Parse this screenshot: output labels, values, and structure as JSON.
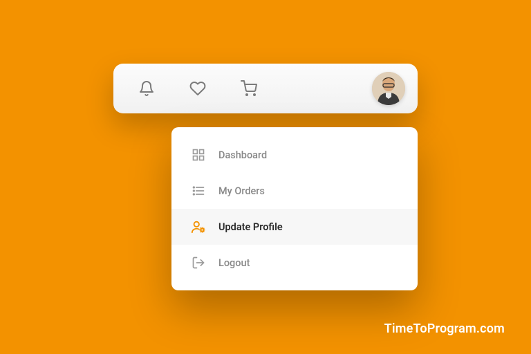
{
  "colors": {
    "background": "#f39200",
    "accent": "#f39200",
    "icon": "#7b7b7b",
    "text_muted": "#888888",
    "text_active": "#2b2b2b"
  },
  "toolbar": {
    "icons": [
      "bell",
      "heart",
      "cart"
    ]
  },
  "menu": {
    "items": [
      {
        "icon": "grid",
        "label": "Dashboard",
        "active": false
      },
      {
        "icon": "list",
        "label": "My Orders",
        "active": false
      },
      {
        "icon": "user-gear",
        "label": "Update Profile",
        "active": true
      },
      {
        "icon": "logout",
        "label": "Logout",
        "active": false
      }
    ]
  },
  "watermark": "TimeToProgram.com"
}
